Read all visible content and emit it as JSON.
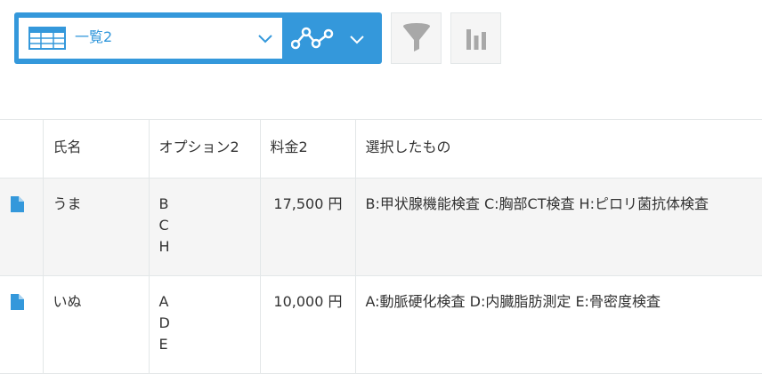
{
  "toolbar": {
    "view_name": "一覧2",
    "icons": {
      "view": "table-icon",
      "graph": "line-graph-icon",
      "filter": "filter-funnel-icon",
      "chart": "bar-chart-icon",
      "dropdown": "chevron-down-icon"
    },
    "colors": {
      "accent": "#3498db",
      "button_bg": "#f5f5f5",
      "icon_gray": "#a8a8a8"
    }
  },
  "table": {
    "headers": [
      "氏名",
      "オプション2",
      "料金2",
      "選択したもの"
    ],
    "rows": [
      {
        "name": "うま",
        "options": [
          "B",
          "C",
          "H"
        ],
        "fee": "17,500 円",
        "selected": "B:甲状腺機能検査 C:胸部CT検査 H:ピロリ菌抗体検査"
      },
      {
        "name": "いぬ",
        "options": [
          "A",
          "D",
          "E"
        ],
        "fee": "10,000 円",
        "selected": "A:動脈硬化検査 D:内臓脂肪測定 E:骨密度検査"
      }
    ]
  }
}
